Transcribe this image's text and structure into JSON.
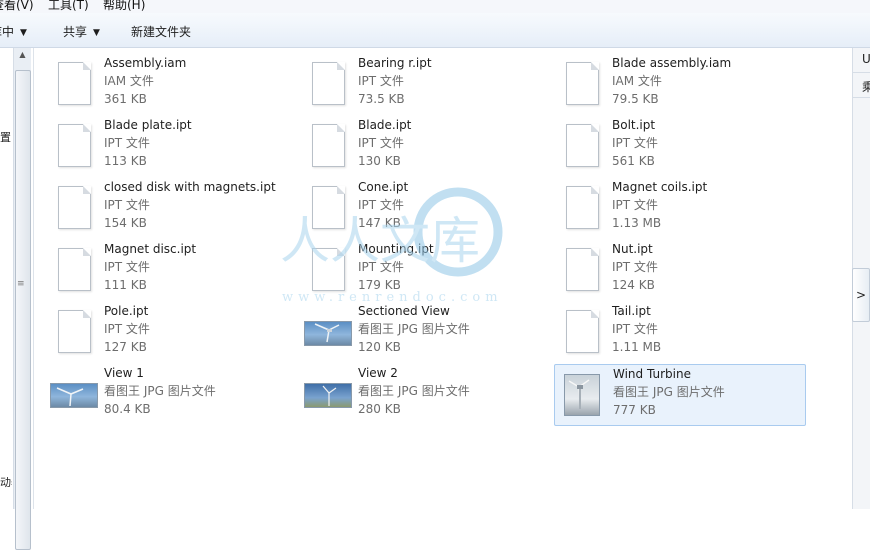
{
  "menubar": {
    "view": "查看(V)",
    "tools": "工具(T)",
    "help": "帮助(H)"
  },
  "toolbar": {
    "include_library": "库中",
    "share": "共享",
    "new_folder": "新建文件夹"
  },
  "nav": {
    "item1": "置",
    "item2": "动器"
  },
  "right_pane": {
    "item1": "U",
    "item2": "乘"
  },
  "watermark": {
    "text_cn": "人人文库",
    "url": "www.renrendoc.com"
  },
  "files": [
    {
      "name": "Assembly.iam",
      "type": "IAM 文件",
      "size": "361 KB",
      "icon": "document-icon"
    },
    {
      "name": "Bearing r.ipt",
      "type": "IPT 文件",
      "size": "73.5 KB",
      "icon": "document-icon"
    },
    {
      "name": "Blade assembly.iam",
      "type": "IAM 文件",
      "size": "79.5 KB",
      "icon": "document-icon"
    },
    {
      "name": "Blade plate.ipt",
      "type": "IPT 文件",
      "size": "113 KB",
      "icon": "document-icon"
    },
    {
      "name": "Blade.ipt",
      "type": "IPT 文件",
      "size": "130 KB",
      "icon": "document-icon"
    },
    {
      "name": "Bolt.ipt",
      "type": "IPT 文件",
      "size": "561 KB",
      "icon": "document-icon"
    },
    {
      "name": "closed disk with magnets.ipt",
      "type": "IPT 文件",
      "size": "154 KB",
      "icon": "document-icon"
    },
    {
      "name": "Cone.ipt",
      "type": "IPT 文件",
      "size": "147 KB",
      "icon": "document-icon"
    },
    {
      "name": "Magnet coils.ipt",
      "type": "IPT 文件",
      "size": "1.13 MB",
      "icon": "document-icon"
    },
    {
      "name": "Magnet disc.ipt",
      "type": "IPT 文件",
      "size": "111 KB",
      "icon": "document-icon"
    },
    {
      "name": "Mounting.ipt",
      "type": "IPT 文件",
      "size": "179 KB",
      "icon": "document-icon"
    },
    {
      "name": "Nut.ipt",
      "type": "IPT 文件",
      "size": "124 KB",
      "icon": "document-icon"
    },
    {
      "name": "Pole.ipt",
      "type": "IPT 文件",
      "size": "127 KB",
      "icon": "document-icon"
    },
    {
      "name": "Sectioned View",
      "type": "看图王 JPG 图片文件",
      "size": "120 KB",
      "icon": "image-thumbnail"
    },
    {
      "name": "Tail.ipt",
      "type": "IPT 文件",
      "size": "1.11 MB",
      "icon": "document-icon"
    },
    {
      "name": "View 1",
      "type": "看图王 JPG 图片文件",
      "size": "80.4 KB",
      "icon": "image-thumbnail"
    },
    {
      "name": "View 2",
      "type": "看图王 JPG 图片文件",
      "size": "280 KB",
      "icon": "image-thumbnail"
    },
    {
      "name": "Wind Turbine",
      "type": "看图王 JPG 图片文件",
      "size": "777 KB",
      "icon": "image-thumbnail",
      "selected": true
    }
  ]
}
